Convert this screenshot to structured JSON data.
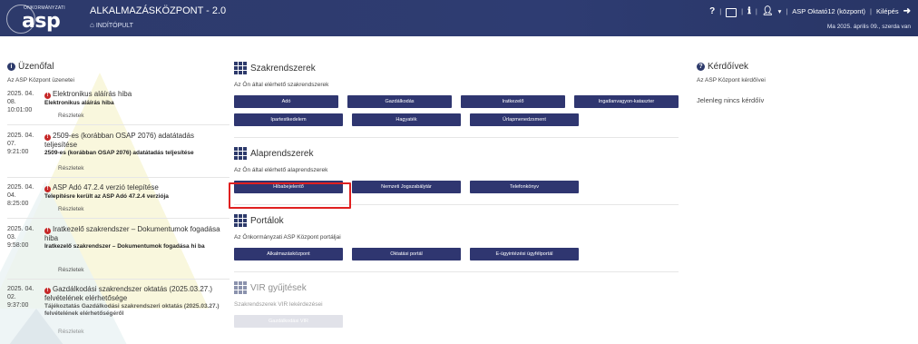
{
  "header": {
    "logo_small": "ÖNKORMÁNYZATI",
    "logo_main": "asp",
    "app_title": "ALKALMAZÁSKÖZPONT - 2.0",
    "home_label": "INDÍTÓPULT",
    "user_label": "ASP Oktató12 (központ)",
    "logout_label": "Kilépés",
    "date_text": "Ma 2025. április 09., szerda van"
  },
  "board": {
    "title": "Üzenőfal",
    "subtitle": "Az ASP Központ üzenetei",
    "more_label": "Részletek",
    "items": [
      {
        "date": "2025. 04. 08.",
        "time": "10:01:00",
        "title": "Elektronikus aláírás hiba",
        "desc": "Elektronikus aláírás hiba"
      },
      {
        "date": "2025. 04. 07.",
        "time": "9:21:00",
        "title": "2509-es (korábban OSAP 2076) adatátadás teljesítése",
        "desc": "2509-es (korábban OSAP 2076) adatátadás teljesítése"
      },
      {
        "date": "2025. 04. 04.",
        "time": "8:25:00",
        "title": "ASP Adó 47.2.4 verzió telepítése",
        "desc": "Telepítésre került az ASP Adó 47.2.4 verziója"
      },
      {
        "date": "2025. 04. 03.",
        "time": "9:58:00",
        "title": "Iratkezelő szakrendszer – Dokumentumok fogadása hiba",
        "desc": "Iratkezelő szakrendszer – Dokumentumok fogadása hi ba"
      },
      {
        "date": "2025. 04. 02.",
        "time": "9:37:00",
        "title": "Gazdálkodási szakrendszer oktatás (2025.03.27.) felvételének elérhetősége",
        "desc": "Tájékoztatás Gazdálkodási szakrendszeri oktatás (2025.03.27.) felvételének elérhetőségéről"
      }
    ]
  },
  "modules": {
    "szak": {
      "title": "Szakrendszerek",
      "subtitle": "Az Ön által elérhető szakrendszerek",
      "buttons": [
        "Adó",
        "Gazdálkodás",
        "Iratkezelő",
        "Ingatlanvagyon-kataszter",
        "Ipartestkedelem",
        "Hagyaték",
        "Űrlapmenedzsment"
      ]
    },
    "alap": {
      "title": "Alaprendszerek",
      "subtitle": "Az Ön által elérhető alaprendszerek",
      "buttons": [
        "Hibabejelentő",
        "Nemzeti Jogszabálytár",
        "Telefonkönyv"
      ]
    },
    "port": {
      "title": "Portálok",
      "subtitle": "Az Önkormányzati ASP Központ portáljai",
      "buttons": [
        "Alkalmazásközpont",
        "Oktatási portál",
        "E-ügyintézési ügyfélportál"
      ]
    },
    "vir": {
      "title": "VIR gyűjtések",
      "subtitle": "Szakrendszerek VIR lekérdezései",
      "buttons": [
        "Gazdálkodási VIR"
      ]
    }
  },
  "surveys": {
    "title": "Kérdőívek",
    "subtitle": "Az ASP Központ kérdőívei",
    "empty_text": "Jelenleg nincs kérdőív"
  },
  "colors": {
    "header_bg": "#2d3a6b",
    "button_bg": "#2f3670",
    "highlight": "#e02020",
    "warning": "#c62828"
  }
}
